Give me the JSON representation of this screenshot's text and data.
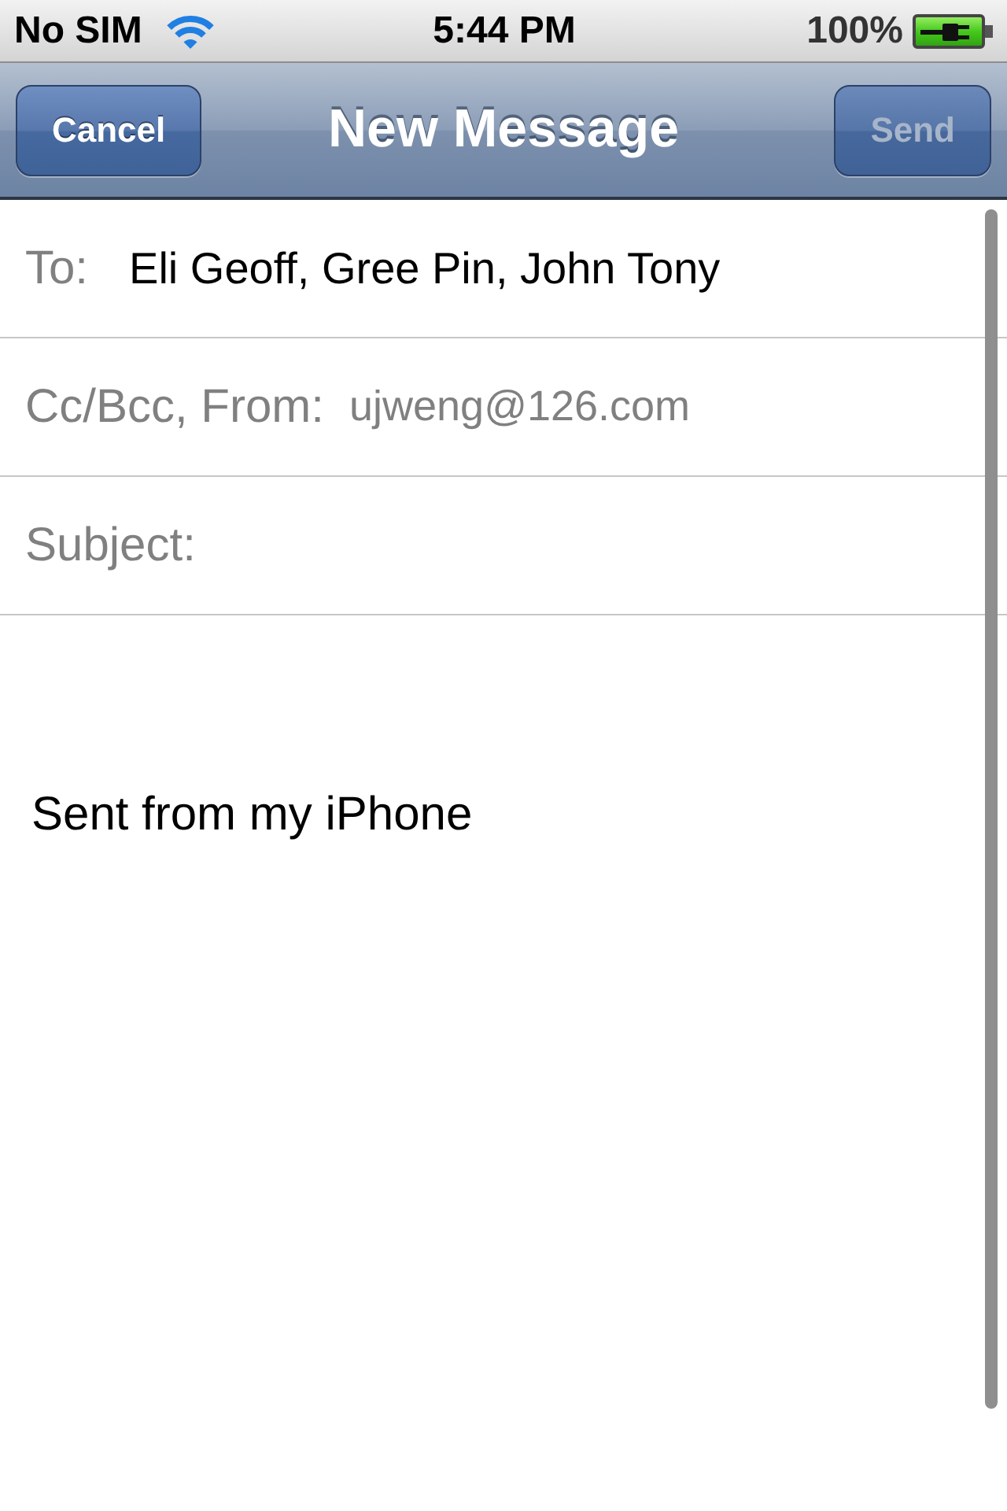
{
  "status_bar": {
    "carrier": "No SIM",
    "time": "5:44 PM",
    "battery": "100%"
  },
  "nav_bar": {
    "title": "New Message",
    "buttons": [
      {
        "label": "Cancel",
        "disabled": false
      },
      {
        "label": "Send",
        "disabled": true
      }
    ]
  },
  "fields": [
    {
      "kind": "recipients",
      "label": "To:",
      "value": "Eli Geoff, Gree Pin, John Tony"
    },
    {
      "kind": "sender",
      "label": "Cc/Bcc, From:",
      "value": "ujweng@126.com"
    },
    {
      "kind": "subject",
      "label": "Subject:"
    }
  ],
  "body": {
    "signature": "Sent from my iPhone"
  }
}
